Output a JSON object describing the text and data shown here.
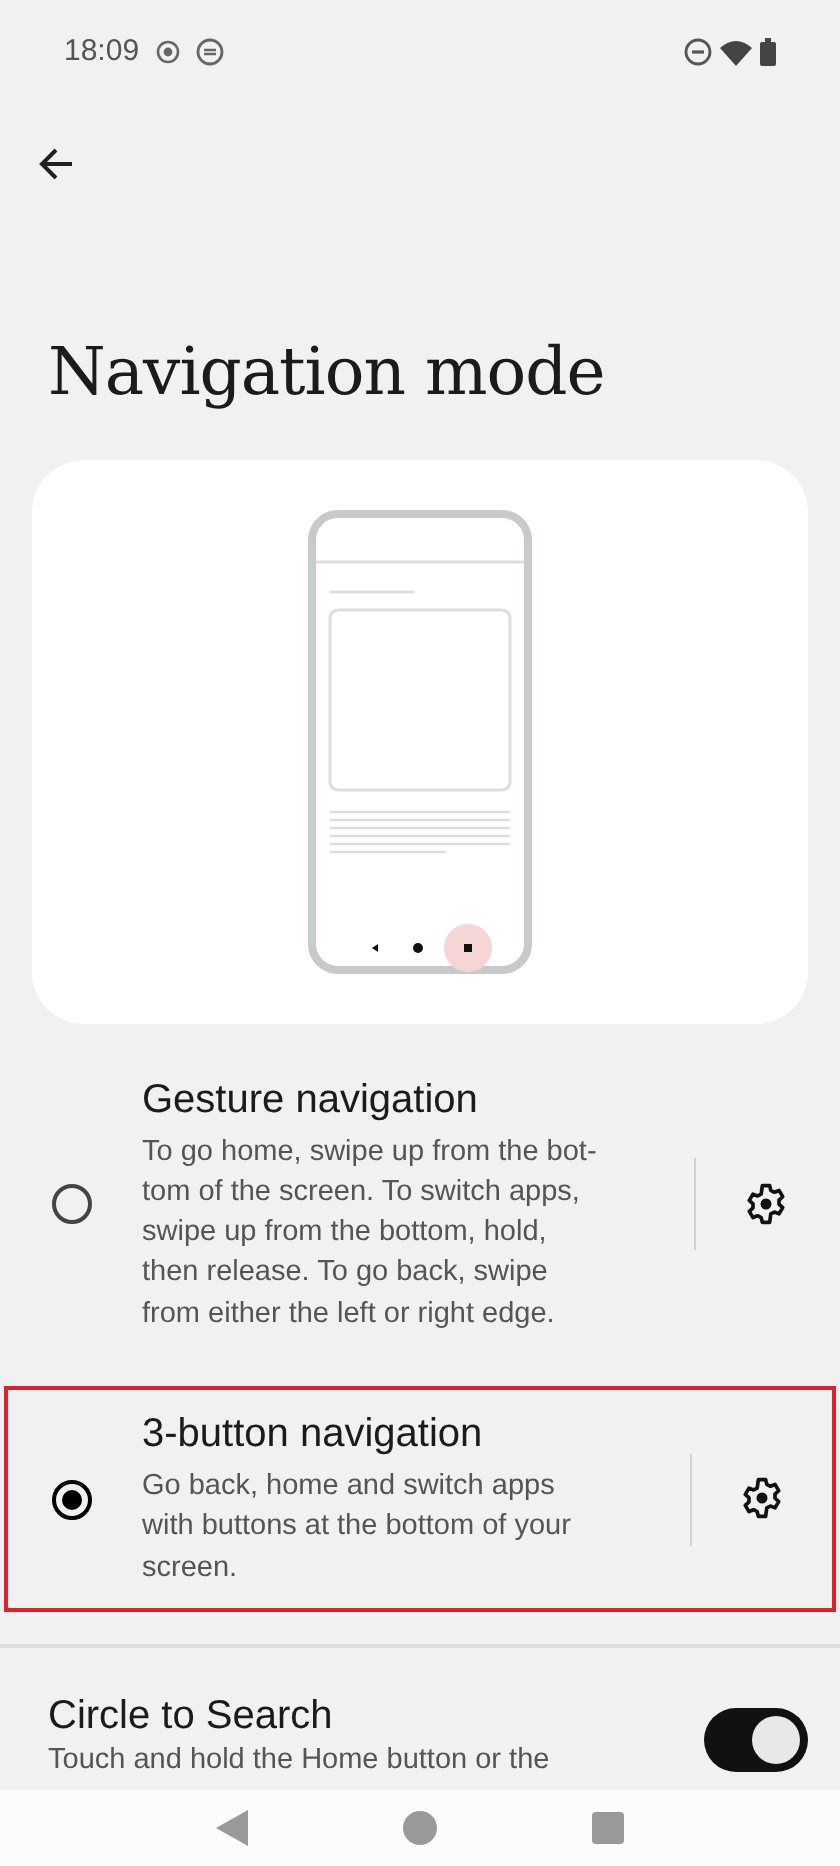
{
  "status_bar": {
    "time": "18:09"
  },
  "title": "Navigation mode",
  "options": [
    {
      "title": "Gesture navigation",
      "description": "To go home, swipe up from the bot-tom of the screen. To switch apps, swipe up from the bottom, hold, then release. To go back, swipe from either the left or right edge.",
      "selected": false,
      "highlighted": false
    },
    {
      "title": "3-button navigation",
      "description": "Go back, home and switch apps with buttons at the bottom of your screen.",
      "selected": true,
      "highlighted": true
    }
  ],
  "toggle_setting": {
    "title": "Circle to Search",
    "description": "Touch and hold the Home button or the",
    "on": true
  }
}
